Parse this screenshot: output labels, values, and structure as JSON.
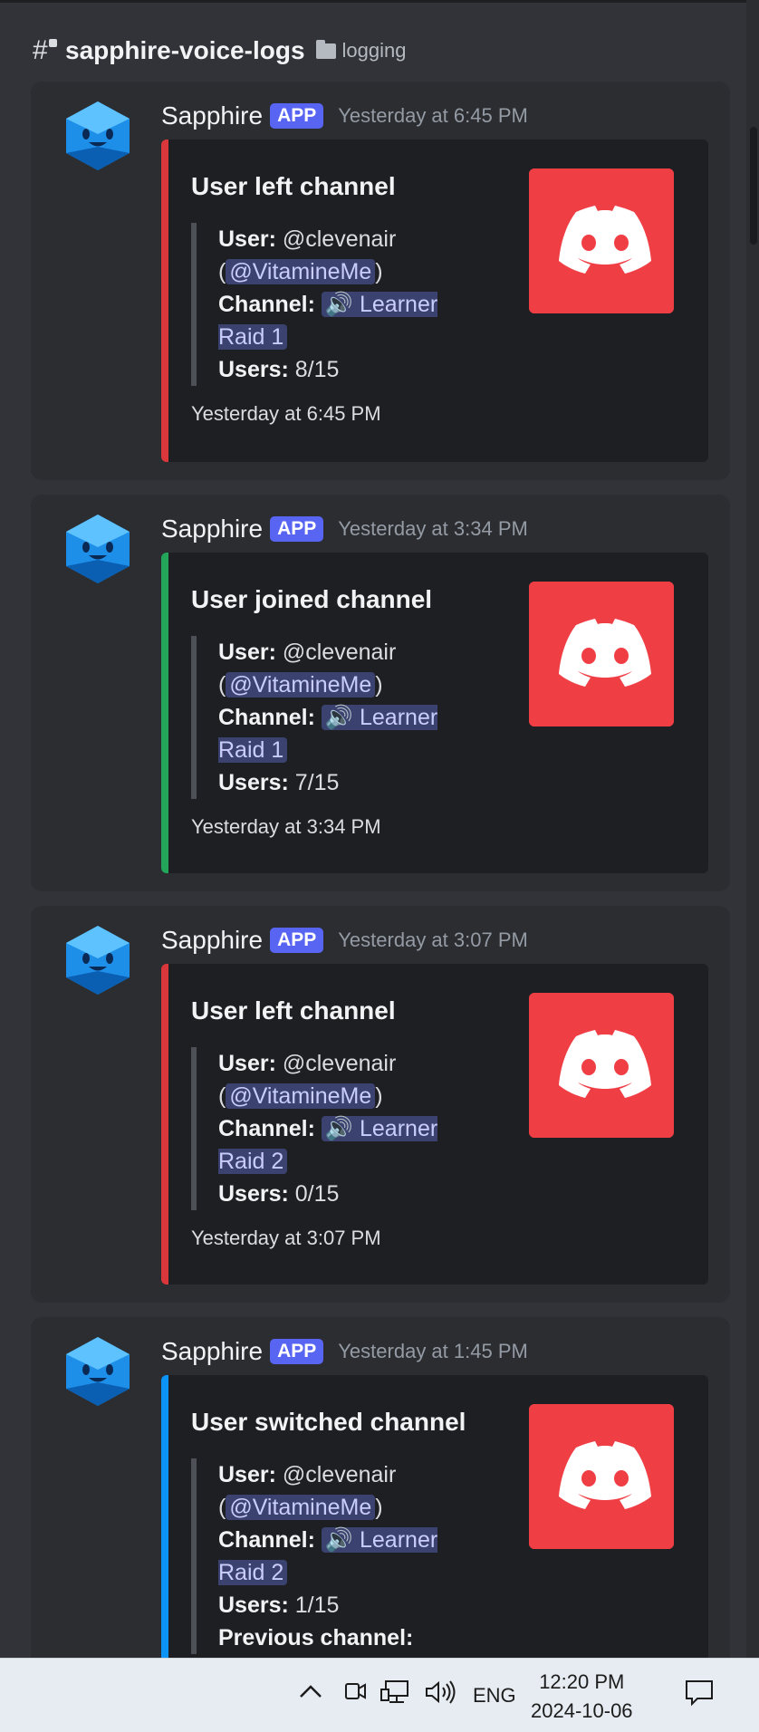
{
  "channel": {
    "name": "sapphire-voice-logs",
    "category": "logging"
  },
  "messages": [
    {
      "author": "Sapphire",
      "badge": "APP",
      "timestamp": "Yesterday at 6:45 PM",
      "title": "User left channel",
      "user_label": "User:",
      "user_name": "@clevenair",
      "mention": "@VitamineMe",
      "channel_label": "Channel:",
      "channel_name": "Learner Raid 1",
      "users_label": "Users:",
      "users": "8/15",
      "footer": "Yesterday at 6:45 PM",
      "accent": "#da373c"
    },
    {
      "author": "Sapphire",
      "badge": "APP",
      "timestamp": "Yesterday at 3:34 PM",
      "title": "User joined channel",
      "user_label": "User:",
      "user_name": "@clevenair",
      "mention": "@VitamineMe",
      "channel_label": "Channel:",
      "channel_name": "Learner Raid 1",
      "users_label": "Users:",
      "users": "7/15",
      "footer": "Yesterday at 3:34 PM",
      "accent": "#23a55a"
    },
    {
      "author": "Sapphire",
      "badge": "APP",
      "timestamp": "Yesterday at 3:07 PM",
      "title": "User left channel",
      "user_label": "User:",
      "user_name": "@clevenair",
      "mention": "@VitamineMe",
      "channel_label": "Channel:",
      "channel_name": "Learner Raid 2",
      "users_label": "Users:",
      "users": "0/15",
      "footer": "Yesterday at 3:07 PM",
      "accent": "#da373c"
    },
    {
      "author": "Sapphire",
      "badge": "APP",
      "timestamp": "Yesterday at 1:45 PM",
      "title": "User switched channel",
      "user_label": "User:",
      "user_name": "@clevenair",
      "mention": "@VitamineMe",
      "channel_label": "Channel:",
      "channel_name": "Learner Raid 2",
      "users_label": "Users:",
      "users": "1/15",
      "prev_label": "Previous channel:",
      "accent": "#0b93f6"
    }
  ],
  "taskbar": {
    "language": "ENG",
    "time": "12:20 PM",
    "date": "2024-10-06"
  }
}
